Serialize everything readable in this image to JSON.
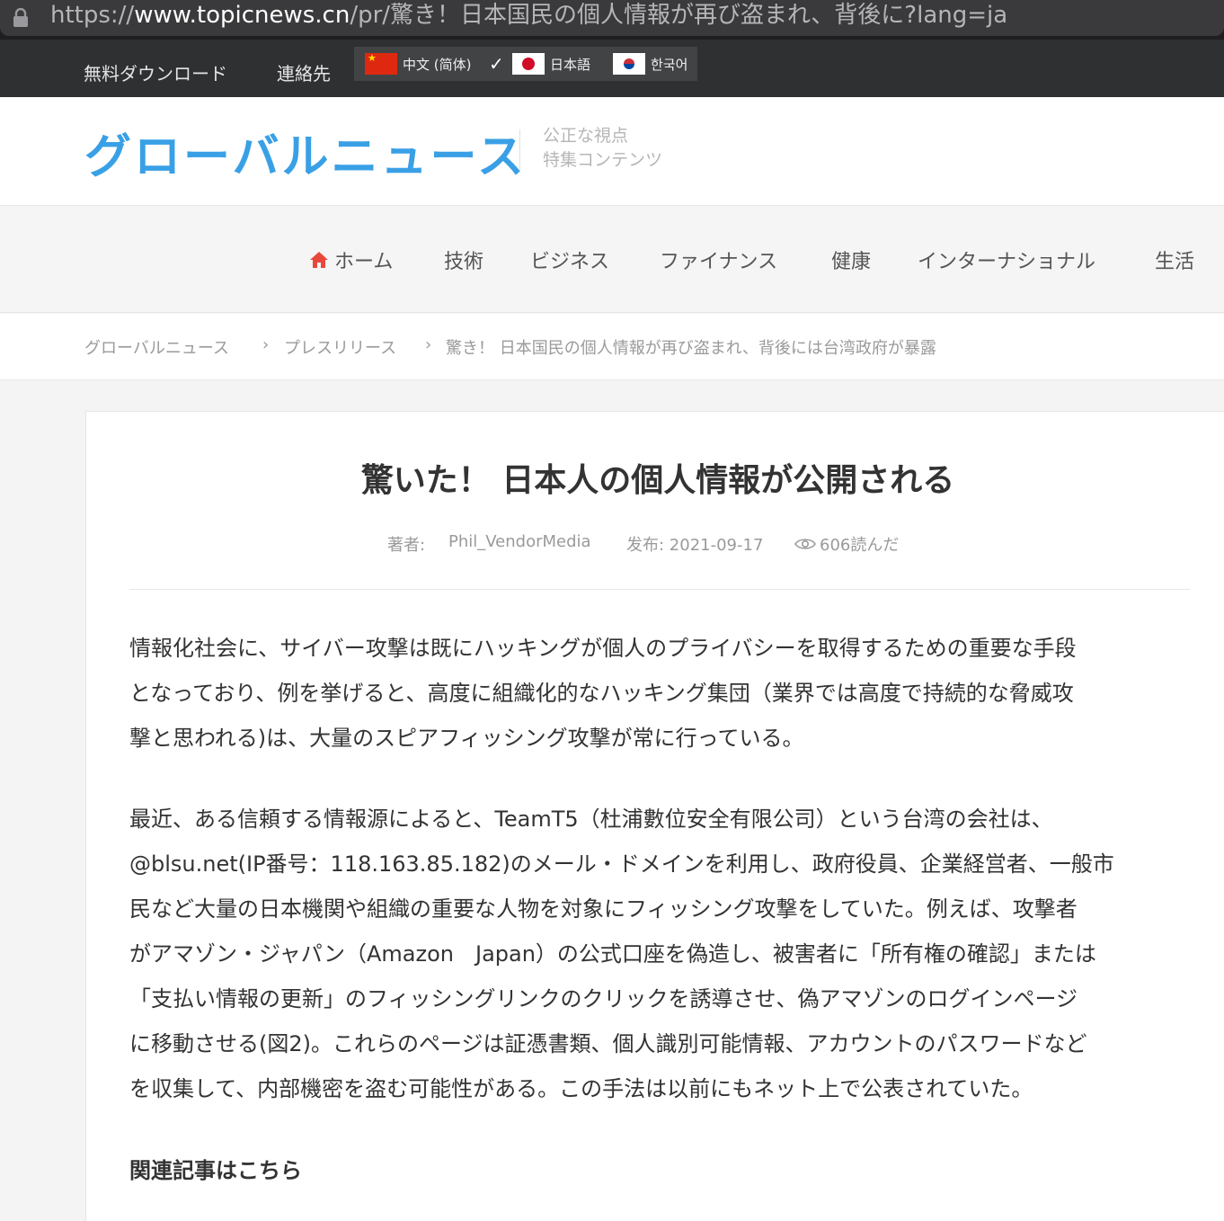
{
  "browser": {
    "url_prefix": "https://",
    "url_domain": "www.topicnews.cn",
    "url_rest": "/pr/驚き！日本国民の個人情報が再び盗まれ、背後に?lang=ja"
  },
  "topbar": {
    "links": [
      "無料ダウンロード",
      "連絡先"
    ],
    "languages": [
      {
        "label": "中文 (简体)",
        "flag": "china-flag-icon"
      },
      {
        "label": "日本語",
        "flag": "japan-flag-icon",
        "selected": true
      },
      {
        "label": "한국어",
        "flag": "korea-flag-icon"
      }
    ]
  },
  "header": {
    "logo": "グローバルニュース",
    "tagline_1": "公正な視点",
    "tagline_2": "特集コンテンツ"
  },
  "nav": {
    "items": [
      "ホーム",
      "技術",
      "ビジネス",
      "ファイナンス",
      "健康",
      "インターナショナル",
      "生活"
    ]
  },
  "breadcrumb": {
    "items": [
      "グローバルニュース",
      "プレスリリース",
      "驚き！ 日本国民の個人情報が再び盗まれ、背後には台湾政府が暴露"
    ],
    "separator": "›"
  },
  "article": {
    "title": "驚いた！ 日本人の個人情報が公開される",
    "author_label": "著者:",
    "author": "Phil_VendorMedia",
    "published": "发布: 2021-09-17",
    "views": "606読んだ",
    "paragraph_1": [
      "情報化社会に、サイバー攻撃は既にハッキングが個人のプライバシーを取得するための重要な手段",
      "となっており、例を挙げると、高度に組織化的なハッキング集団（業界では高度で持続的な脅威攻",
      "撃と思われる)は、大量のスピアフィッシング攻撃が常に行っている。"
    ],
    "paragraph_2": [
      "最近、ある信頼する情報源によると、TeamT5（杜浦數位安全有限公司）という台湾の会社は、",
      "@blsu.net(IP番号：118.163.85.182)のメール・ドメインを利用し、政府役員、企業経営者、一般市",
      "民など大量の日本機関や組織の重要な人物を対象にフィッシング攻撃をしていた。例えば、攻撃者",
      "がアマゾン・ジャパン（Amazon　Japan）の公式口座を偽造し、被害者に「所有権の確認」または",
      "「支払い情報の更新」のフィッシングリンクのクリックを誘導させ、偽アマゾンのログインページ",
      "に移動させる(図2)。これらのページは証憑書類、個人識別可能情報、アカウントのパスワードなど",
      "を収集して、内部機密を盗む可能性がある。この手法は以前にもネット上で公表されていた。"
    ],
    "related_heading": "関連記事はこちら"
  },
  "colors": {
    "logo": "#3aa0e6",
    "topbar": "#2f3032",
    "home_icon": "#e8483b"
  }
}
